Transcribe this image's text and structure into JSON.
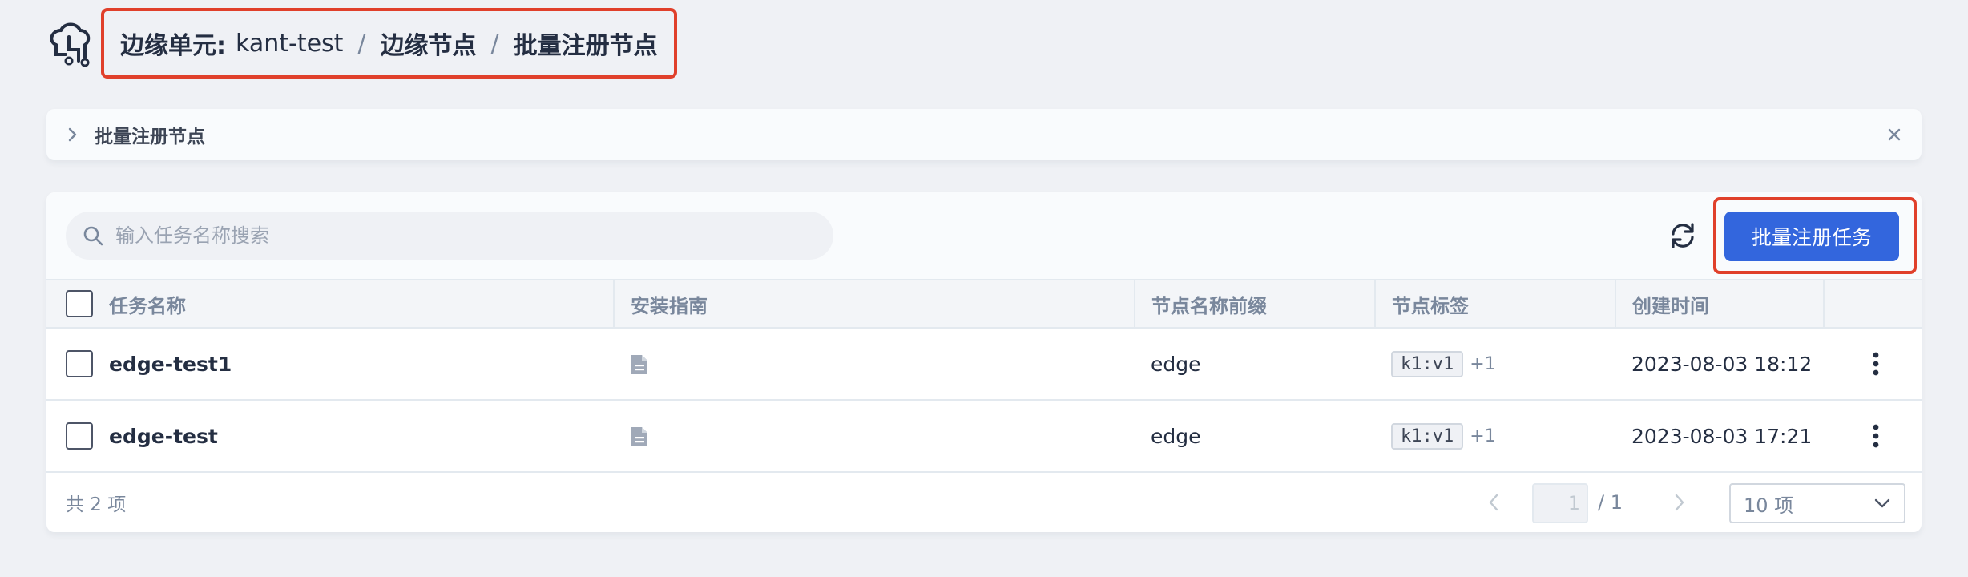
{
  "breadcrumb": {
    "unit_label": "边缘单元:",
    "unit_value": "kant-test",
    "sep": "/",
    "level2": "边缘节点",
    "level3": "批量注册节点"
  },
  "banner": {
    "title": "批量注册节点",
    "chevron_icon": "chevron-right-icon",
    "close_icon": "close-icon"
  },
  "toolbar": {
    "search_placeholder": "输入任务名称搜索",
    "search_value": "",
    "refresh_icon": "refresh-icon",
    "create_label": "批量注册任务",
    "accent_color": "#3366dd",
    "highlight_color": "#e0402b"
  },
  "table": {
    "columns": [
      "任务名称",
      "安装指南",
      "节点名称前缀",
      "节点标签",
      "创建时间"
    ],
    "rows": [
      {
        "name": "edge-test1",
        "guide_icon": "document-icon",
        "prefix": "edge",
        "tag": "k1:v1",
        "tag_more": "+1",
        "created": "2023-08-03 18:12"
      },
      {
        "name": "edge-test",
        "guide_icon": "document-icon",
        "prefix": "edge",
        "tag": "k1:v1",
        "tag_more": "+1",
        "created": "2023-08-03 17:21"
      }
    ]
  },
  "footer": {
    "total": "共 2 项",
    "page_current": "1",
    "page_total": "/ 1",
    "page_size": "10 项"
  }
}
